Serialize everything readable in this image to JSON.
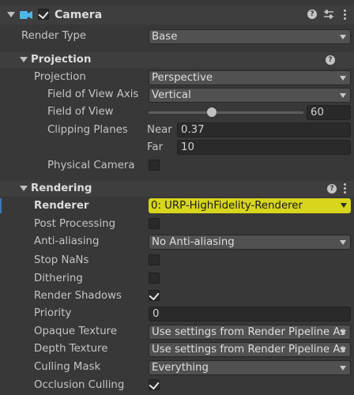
{
  "camera": {
    "title": "Camera",
    "enabled": true
  },
  "render_type": {
    "label": "Render Type",
    "value": "Base"
  },
  "projection_section": {
    "title": "Projection",
    "projection": {
      "label": "Projection",
      "value": "Perspective"
    },
    "fov_axis": {
      "label": "Field of View Axis",
      "value": "Vertical"
    },
    "fov": {
      "label": "Field of View",
      "value": "60"
    },
    "clipping": {
      "label": "Clipping Planes",
      "near_label": "Near",
      "near": "0.37",
      "far_label": "Far",
      "far": "10"
    },
    "physical_camera": {
      "label": "Physical Camera",
      "checked": false
    }
  },
  "rendering_section": {
    "title": "Rendering",
    "renderer": {
      "label": "Renderer",
      "value": "0: URP-HighFidelity-Renderer"
    },
    "post_processing": {
      "label": "Post Processing",
      "checked": false
    },
    "anti_aliasing": {
      "label": "Anti-aliasing",
      "value": "No Anti-aliasing"
    },
    "stop_nans": {
      "label": "Stop NaNs",
      "checked": false
    },
    "dithering": {
      "label": "Dithering",
      "checked": false
    },
    "render_shadows": {
      "label": "Render Shadows",
      "checked": true
    },
    "priority": {
      "label": "Priority",
      "value": "0"
    },
    "opaque_texture": {
      "label": "Opaque Texture",
      "value": "Use settings from Render Pipeline As"
    },
    "depth_texture": {
      "label": "Depth Texture",
      "value": "Use settings from Render Pipeline As"
    },
    "culling_mask": {
      "label": "Culling Mask",
      "value": "Everything"
    },
    "occlusion_culling": {
      "label": "Occlusion Culling",
      "checked": true
    }
  },
  "icons": {
    "help": "?",
    "slider_fill_fraction": 0.41
  },
  "colors": {
    "highlight": "#d7d51c",
    "camera_icon": "#4db6e8",
    "selected_accent": "#3a79bb"
  }
}
